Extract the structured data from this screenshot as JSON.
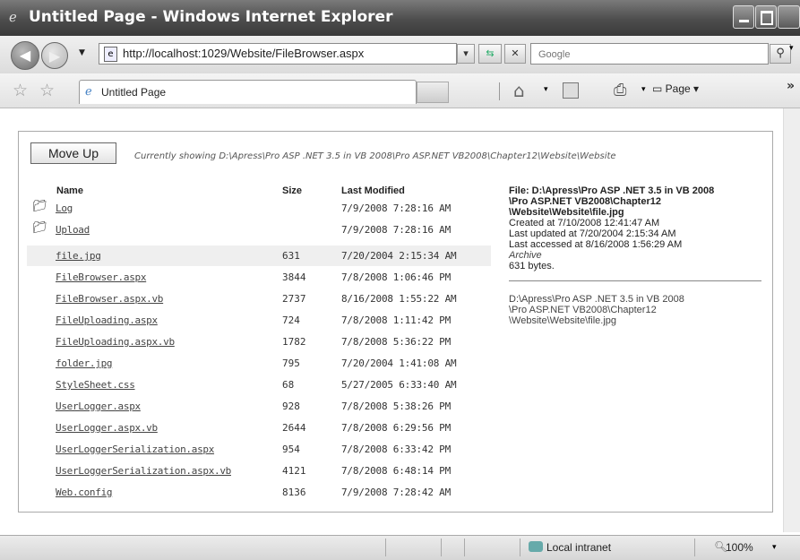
{
  "window": {
    "title": "Untitled Page - Windows Internet Explorer"
  },
  "address": {
    "url": "http://localhost:1029/Website/FileBrowser.aspx"
  },
  "search": {
    "placeholder": "Google"
  },
  "tab": {
    "label": "Untitled Page"
  },
  "commands": {
    "page_label": "Page"
  },
  "content": {
    "move_up_label": "Move Up",
    "current_dir": "Currently showing D:\\Apress\\Pro ASP .NET 3.5 in VB 2008\\Pro ASP.NET VB2008\\Chapter12\\Website\\Website",
    "headers": {
      "name": "Name",
      "size": "Size",
      "modified": "Last Modified"
    },
    "folders": [
      {
        "name": "Log",
        "size": "",
        "modified": "7/9/2008 7:28:16 AM"
      },
      {
        "name": "Upload",
        "size": "",
        "modified": "7/9/2008 7:28:16 AM"
      }
    ],
    "files": [
      {
        "name": "file.jpg",
        "size": "631",
        "modified": "7/20/2004 2:15:34 AM"
      },
      {
        "name": "FileBrowser.aspx",
        "size": "3844",
        "modified": "7/8/2008 1:06:46 PM"
      },
      {
        "name": "FileBrowser.aspx.vb",
        "size": "2737",
        "modified": "8/16/2008 1:55:22 AM"
      },
      {
        "name": "FileUploading.aspx",
        "size": "724",
        "modified": "7/8/2008 1:11:42 PM"
      },
      {
        "name": "FileUploading.aspx.vb",
        "size": "1782",
        "modified": "7/8/2008 5:36:22 PM"
      },
      {
        "name": "folder.jpg",
        "size": "795",
        "modified": "7/20/2004 1:41:08 AM"
      },
      {
        "name": "StyleSheet.css",
        "size": "68",
        "modified": "5/27/2005 6:33:40 AM"
      },
      {
        "name": "UserLogger.aspx",
        "size": "928",
        "modified": "7/8/2008 5:38:26 PM"
      },
      {
        "name": "UserLogger.aspx.vb",
        "size": "2644",
        "modified": "7/8/2008 6:29:56 PM"
      },
      {
        "name": "UserLoggerSerialization.aspx",
        "size": "954",
        "modified": "7/8/2008 6:33:42 PM"
      },
      {
        "name": "UserLoggerSerialization.aspx.vb",
        "size": "4121",
        "modified": "7/8/2008 6:48:14 PM"
      },
      {
        "name": "Web.config",
        "size": "8136",
        "modified": "7/9/2008 7:28:42 AM"
      }
    ],
    "details": {
      "file_line1": "File: D:\\Apress\\Pro ASP .NET 3.5 in VB 2008",
      "file_line2": "\\Pro ASP.NET VB2008\\Chapter12",
      "file_line3": "\\Website\\Website\\file.jpg",
      "created": "Created at 7/10/2008 12:41:47 AM",
      "updated": "Last updated at 7/20/2004 2:15:34 AM",
      "accessed": "Last accessed at 8/16/2008 1:56:29 AM",
      "attributes": "Archive",
      "bytes": "631 bytes.",
      "path_line1": "D:\\Apress\\Pro ASP .NET 3.5 in VB 2008",
      "path_line2": "\\Pro ASP.NET VB2008\\Chapter12",
      "path_line3": "\\Website\\Website\\file.jpg"
    }
  },
  "status": {
    "zone": "Local intranet",
    "zoom": "100%"
  }
}
